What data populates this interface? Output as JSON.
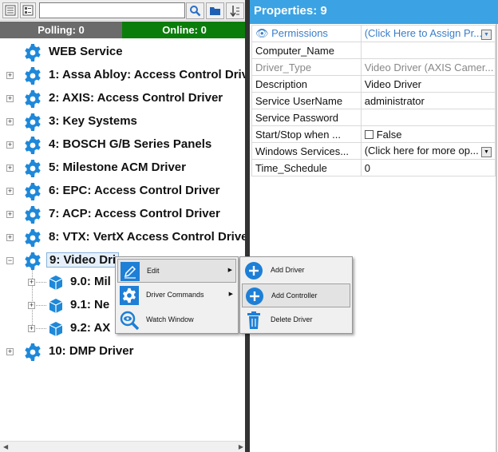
{
  "toolbar": {
    "search_value": "",
    "icon_colors": {
      "search": "#2b6fc5",
      "folder": "#1f5fb3"
    }
  },
  "status": {
    "polling": "Polling: 0",
    "online": "Online: 0"
  },
  "tree": {
    "root": "WEB Service",
    "items": [
      "1:  Assa Abloy: Access Control Drive",
      "2:  AXIS: Access Control Driver",
      "3:  Key Systems",
      "4:  BOSCH G/B Series Panels",
      "5:  Milestone ACM Driver",
      "6:  EPC: Access Control Driver",
      "7:  ACP: Access Control Driver",
      "8:  VTX: VertX Access Control Driver",
      "9:  Video Dri",
      "10:  DMP Driver"
    ],
    "children": [
      "9.0:  Mil",
      "9.1:  Ne",
      "9.2:  AX"
    ],
    "expand_plus": "+",
    "expand_minus": "−"
  },
  "properties": {
    "header": "Properties:  9",
    "rows": [
      {
        "key": "Permissions",
        "value": "(Click Here to Assign Pr..."
      },
      {
        "key": "Computer_Name",
        "value": ""
      },
      {
        "key": "Driver_Type",
        "value": "Video Driver (AXIS Camer..."
      },
      {
        "key": "Description",
        "value": "Video Driver"
      },
      {
        "key": "Service UserName",
        "value": "administrator"
      },
      {
        "key": "Service Password",
        "value": ""
      },
      {
        "key": "Start/Stop when ...",
        "value": "False"
      },
      {
        "key": "Windows Services...",
        "value": "(Click here for more op..."
      },
      {
        "key": "Time_Schedule",
        "value": "0"
      }
    ]
  },
  "context_menu": {
    "items": [
      {
        "label": "Edit",
        "icon": "pencil-icon"
      },
      {
        "label": "Driver Commands",
        "icon": "gear-icon"
      },
      {
        "label": "Watch Window",
        "icon": "magnifier-eye-icon"
      }
    ],
    "submenu": [
      {
        "label": "Add Driver",
        "icon": "plus-circle-icon"
      },
      {
        "label": "Add Controller",
        "icon": "plus-circle-icon"
      },
      {
        "label": "Delete Driver",
        "icon": "trash-icon"
      }
    ]
  },
  "colors": {
    "header_blue": "#3ba3e3",
    "online_green": "#0b7d0b",
    "polling_gray": "#6b6b6b",
    "gear_blue": "#1e88d9",
    "menu_icon_blue": "#1e7fd6"
  }
}
